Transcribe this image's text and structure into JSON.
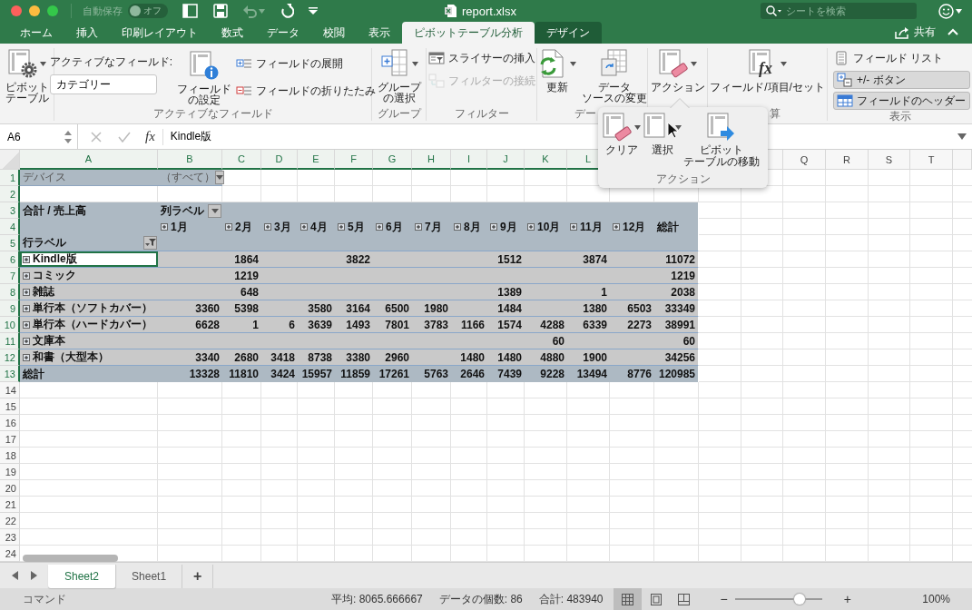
{
  "window": {
    "title": "report.xlsx",
    "autosave": {
      "label": "自動保存",
      "toggle_text": "オフ",
      "on": false
    },
    "search": {
      "placeholder": "シートを検索"
    }
  },
  "ribbon_tabs": [
    {
      "label": "ホーム",
      "selected": false,
      "contextual": false
    },
    {
      "label": "挿入",
      "selected": false,
      "contextual": false
    },
    {
      "label": "印刷レイアウト",
      "selected": false,
      "contextual": false
    },
    {
      "label": "数式",
      "selected": false,
      "contextual": false
    },
    {
      "label": "データ",
      "selected": false,
      "contextual": false
    },
    {
      "label": "校閲",
      "selected": false,
      "contextual": false
    },
    {
      "label": "表示",
      "selected": false,
      "contextual": false
    },
    {
      "label": "ピボットテーブル分析",
      "selected": true,
      "contextual": true
    },
    {
      "label": "デザイン",
      "selected": false,
      "contextual": true
    }
  ],
  "share": {
    "label": "共有"
  },
  "ribbon_groups": [
    {
      "columns": [
        [
          {
            "kind": "large",
            "label": "ピボットテーブル",
            "dropdown": true,
            "disabled": false
          }
        ]
      ]
    },
    {
      "label": "アクティブなフィールド",
      "columns": [
        [
          {
            "kind": "caption",
            "label": "アクティブなフィールド:"
          },
          {
            "kind": "field",
            "value": "カテゴリー"
          }
        ],
        [
          {
            "kind": "large",
            "label": "フィールドの設定",
            "dropdown": false,
            "disabled": false
          }
        ],
        [
          {
            "kind": "small",
            "label": "フィールドの展開",
            "disabled": false
          },
          {
            "kind": "small",
            "label": "フィールドの折りたたみ",
            "disabled": false
          }
        ]
      ]
    },
    {
      "label": "グループ",
      "columns": [
        [
          {
            "kind": "large",
            "label": "グループの選択",
            "dropdown": true,
            "disabled": false
          }
        ]
      ]
    },
    {
      "label": "フィルター",
      "columns": [
        [
          {
            "kind": "small",
            "label": "スライサーの挿入",
            "disabled": false
          },
          {
            "kind": "small",
            "label": "フィルターの接続",
            "disabled": true
          }
        ]
      ]
    },
    {
      "label": "デー",
      "columns": [
        [
          {
            "kind": "large",
            "label": "更新",
            "dropdown": true,
            "disabled": false
          }
        ],
        [
          {
            "kind": "large",
            "label": "データソースの変更",
            "dropdown": false,
            "disabled": false
          }
        ]
      ]
    },
    {
      "columns": [
        [
          {
            "kind": "large",
            "label": "アクション",
            "dropdown": true,
            "disabled": false
          }
        ]
      ]
    },
    {
      "label": "算",
      "columns": [
        [
          {
            "kind": "large",
            "label": "フィールド/項目/セット",
            "icon_text": "fx",
            "dropdown": true,
            "disabled": false
          }
        ]
      ]
    },
    {
      "label": "表示",
      "columns": [
        [
          {
            "kind": "small",
            "label": "フィールド リスト",
            "disabled": false
          },
          {
            "kind": "toggle",
            "label": "+/- ボタン",
            "selected": true
          },
          {
            "kind": "toggle",
            "label": "フィールドのヘッダー",
            "selected": true
          }
        ]
      ]
    }
  ],
  "action_popup": {
    "label": "アクション",
    "items": [
      {
        "label": "クリア",
        "dropdown": true
      },
      {
        "label": "選択",
        "dropdown": true
      },
      {
        "label": "ピボットテーブルの移動",
        "dropdown": false
      }
    ]
  },
  "formula_bar": {
    "cell": "A6",
    "fx_label": "fx",
    "content": "Kindle版"
  },
  "column_headers_left": [
    {
      "label": "A",
      "selected": true
    },
    {
      "label": "B",
      "selected": true
    },
    {
      "label": "C",
      "selected": true
    },
    {
      "label": "D",
      "selected": true
    },
    {
      "label": "E",
      "selected": true
    },
    {
      "label": "F",
      "selected": true
    },
    {
      "label": "G",
      "selected": true
    },
    {
      "label": "H",
      "selected": true
    },
    {
      "label": "I",
      "selected": true
    },
    {
      "label": "J",
      "selected": true
    },
    {
      "label": "K",
      "selected": true
    },
    {
      "label": "L",
      "selected": true
    }
  ],
  "column_headers_right": [
    {
      "label": "Q",
      "selected": false
    },
    {
      "label": "R",
      "selected": false
    },
    {
      "label": "S",
      "selected": false
    },
    {
      "label": "T",
      "selected": false
    }
  ],
  "row_numbers": [
    {
      "label": "1",
      "selected": true
    },
    {
      "label": "2",
      "selected": true
    },
    {
      "label": "3",
      "selected": true
    },
    {
      "label": "4",
      "selected": true
    },
    {
      "label": "5",
      "selected": true
    },
    {
      "label": "6",
      "selected": true
    },
    {
      "label": "7",
      "selected": true
    },
    {
      "label": "8",
      "selected": true
    },
    {
      "label": "9",
      "selected": true
    },
    {
      "label": "10",
      "selected": true
    },
    {
      "label": "11",
      "selected": true
    },
    {
      "label": "12",
      "selected": true
    },
    {
      "label": "13",
      "selected": true
    },
    {
      "label": "14",
      "selected": false
    },
    {
      "label": "15",
      "selected": false
    },
    {
      "label": "16",
      "selected": false
    },
    {
      "label": "17",
      "selected": false
    },
    {
      "label": "18",
      "selected": false
    },
    {
      "label": "19",
      "selected": false
    },
    {
      "label": "20",
      "selected": false
    },
    {
      "label": "21",
      "selected": false
    },
    {
      "label": "22",
      "selected": false
    },
    {
      "label": "23",
      "selected": false
    },
    {
      "label": "24",
      "selected": false
    }
  ],
  "report_filter": {
    "field": "デバイス",
    "value": "（すべて）"
  },
  "pivot": {
    "value_label": "合計 / 売上高",
    "column_label": "列ラベル",
    "row_label": "行ラベル",
    "total_header": "総計",
    "columns": [
      {
        "label": "1月",
        "expanded": false
      },
      {
        "label": "2月",
        "expanded": false
      },
      {
        "label": "3月",
        "expanded": false
      },
      {
        "label": "4月",
        "expanded": false
      },
      {
        "label": "5月",
        "expanded": false
      },
      {
        "label": "6月",
        "expanded": false
      },
      {
        "label": "7月",
        "expanded": false
      },
      {
        "label": "8月",
        "expanded": false
      },
      {
        "label": "9月",
        "expanded": false
      },
      {
        "label": "10月",
        "expanded": false
      },
      {
        "label": "11月",
        "expanded": false
      },
      {
        "label": "12月",
        "expanded": false
      }
    ],
    "rows": [
      {
        "label": "Kindle版",
        "expanded": false,
        "selected": true,
        "values": [
          {
            "kind": "blank"
          },
          {
            "kind": "number",
            "text": "1864"
          },
          {
            "kind": "blank"
          },
          {
            "kind": "blank"
          },
          {
            "kind": "number",
            "text": "3822"
          },
          {
            "kind": "blank"
          },
          {
            "kind": "blank"
          },
          {
            "kind": "blank"
          },
          {
            "kind": "number",
            "text": "1512"
          },
          {
            "kind": "blank"
          },
          {
            "kind": "number",
            "text": "3874"
          },
          {
            "kind": "blank"
          }
        ],
        "total": "11072"
      },
      {
        "label": "コミック",
        "expanded": false,
        "selected": false,
        "values": [
          {
            "kind": "blank"
          },
          {
            "kind": "number",
            "text": "1219"
          },
          {
            "kind": "blank"
          },
          {
            "kind": "blank"
          },
          {
            "kind": "blank"
          },
          {
            "kind": "blank"
          },
          {
            "kind": "blank"
          },
          {
            "kind": "blank"
          },
          {
            "kind": "blank"
          },
          {
            "kind": "blank"
          },
          {
            "kind": "blank"
          },
          {
            "kind": "blank"
          }
        ],
        "total": "1219"
      },
      {
        "label": "雑誌",
        "expanded": false,
        "selected": false,
        "values": [
          {
            "kind": "blank"
          },
          {
            "kind": "number",
            "text": "648"
          },
          {
            "kind": "blank"
          },
          {
            "kind": "blank"
          },
          {
            "kind": "blank"
          },
          {
            "kind": "blank"
          },
          {
            "kind": "blank"
          },
          {
            "kind": "blank"
          },
          {
            "kind": "number",
            "text": "1389"
          },
          {
            "kind": "blank"
          },
          {
            "kind": "number",
            "text": "1"
          },
          {
            "kind": "blank"
          }
        ],
        "total": "2038"
      },
      {
        "label": "単行本（ソフトカバー）",
        "expanded": false,
        "selected": false,
        "values": [
          {
            "kind": "number",
            "text": "3360"
          },
          {
            "kind": "number",
            "text": "5398"
          },
          {
            "kind": "blank"
          },
          {
            "kind": "number",
            "text": "3580"
          },
          {
            "kind": "number",
            "text": "3164"
          },
          {
            "kind": "number",
            "text": "6500"
          },
          {
            "kind": "number",
            "text": "1980"
          },
          {
            "kind": "blank"
          },
          {
            "kind": "number",
            "text": "1484"
          },
          {
            "kind": "blank"
          },
          {
            "kind": "number",
            "text": "1380"
          },
          {
            "kind": "number",
            "text": "6503"
          }
        ],
        "total": "33349"
      },
      {
        "label": "単行本（ハードカバー）",
        "expanded": false,
        "selected": false,
        "values": [
          {
            "kind": "number",
            "text": "6628"
          },
          {
            "kind": "number",
            "text": "1"
          },
          {
            "kind": "number",
            "text": "6"
          },
          {
            "kind": "number",
            "text": "3639"
          },
          {
            "kind": "number",
            "text": "1493"
          },
          {
            "kind": "number",
            "text": "7801"
          },
          {
            "kind": "number",
            "text": "3783"
          },
          {
            "kind": "number",
            "text": "1166"
          },
          {
            "kind": "number",
            "text": "1574"
          },
          {
            "kind": "number",
            "text": "4288"
          },
          {
            "kind": "number",
            "text": "6339"
          },
          {
            "kind": "number",
            "text": "2273"
          }
        ],
        "total": "38991"
      },
      {
        "label": "文庫本",
        "expanded": false,
        "selected": false,
        "values": [
          {
            "kind": "blank"
          },
          {
            "kind": "blank"
          },
          {
            "kind": "blank"
          },
          {
            "kind": "blank"
          },
          {
            "kind": "blank"
          },
          {
            "kind": "blank"
          },
          {
            "kind": "blank"
          },
          {
            "kind": "blank"
          },
          {
            "kind": "blank"
          },
          {
            "kind": "number",
            "text": "60"
          },
          {
            "kind": "blank"
          },
          {
            "kind": "blank"
          }
        ],
        "total": "60"
      },
      {
        "label": "和書（大型本）",
        "expanded": false,
        "selected": false,
        "values": [
          {
            "kind": "number",
            "text": "3340"
          },
          {
            "kind": "number",
            "text": "2680"
          },
          {
            "kind": "number",
            "text": "3418"
          },
          {
            "kind": "number",
            "text": "8738"
          },
          {
            "kind": "number",
            "text": "3380"
          },
          {
            "kind": "number",
            "text": "2960"
          },
          {
            "kind": "blank"
          },
          {
            "kind": "number",
            "text": "1480"
          },
          {
            "kind": "number",
            "text": "1480"
          },
          {
            "kind": "number",
            "text": "4880"
          },
          {
            "kind": "number",
            "text": "1900"
          },
          {
            "kind": "blank"
          }
        ],
        "total": "34256"
      }
    ],
    "grand_total": {
      "label": "総計",
      "values": [
        {
          "kind": "number",
          "text": "13328"
        },
        {
          "kind": "number",
          "text": "11810"
        },
        {
          "kind": "number",
          "text": "3424"
        },
        {
          "kind": "number",
          "text": "15957"
        },
        {
          "kind": "number",
          "text": "11859"
        },
        {
          "kind": "number",
          "text": "17261"
        },
        {
          "kind": "number",
          "text": "5763"
        },
        {
          "kind": "number",
          "text": "2646"
        },
        {
          "kind": "number",
          "text": "7439"
        },
        {
          "kind": "number",
          "text": "9228"
        },
        {
          "kind": "number",
          "text": "13494"
        },
        {
          "kind": "number",
          "text": "8776"
        }
      ],
      "total": "120985"
    }
  },
  "sheet_tabs": [
    {
      "label": "Sheet2",
      "selected": true
    },
    {
      "label": "Sheet1",
      "selected": false
    }
  ],
  "add_sheet": "+",
  "status_bar": {
    "mode": "コマンド",
    "average": "平均: 8065.666667",
    "count": "データの個数: 86",
    "sum": "合計: 483940",
    "views": [
      {
        "selected": true
      },
      {
        "selected": false
      },
      {
        "selected": false
      }
    ],
    "zoom": {
      "minus": "−",
      "plus": "+",
      "level": 0.74,
      "percent": "100%"
    }
  }
}
